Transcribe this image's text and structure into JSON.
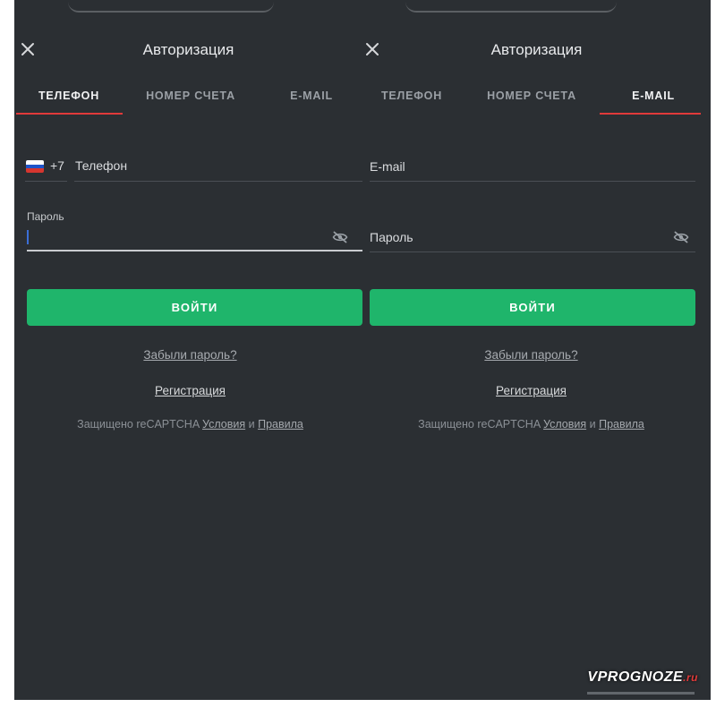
{
  "left": {
    "title": "Авторизация",
    "tabs": [
      {
        "label": "ТЕЛЕФОН",
        "active": true
      },
      {
        "label": "НОМЕР СЧЕТА",
        "active": false
      },
      {
        "label": "E-MAIL",
        "active": false
      }
    ],
    "phone": {
      "code": "+7",
      "placeholder": "Телефон"
    },
    "password_label": "Пароль",
    "login_button": "ВОЙТИ",
    "forgot_link": "Забыли пароль?",
    "register_link": "Регистрация",
    "captcha": {
      "prefix": "Защищено reCAPTCHA",
      "terms": "Условия",
      "and": "и",
      "rules": "Правила"
    }
  },
  "right": {
    "title": "Авторизация",
    "tabs": [
      {
        "label": "ТЕЛЕФОН",
        "active": false
      },
      {
        "label": "НОМЕР СЧЕТА",
        "active": false
      },
      {
        "label": "E-MAIL",
        "active": true
      }
    ],
    "email_placeholder": "E-mail",
    "password_placeholder": "Пароль",
    "login_button": "ВОЙТИ",
    "forgot_link": "Забыли пароль?",
    "register_link": "Регистрация",
    "captcha": {
      "prefix": "Защищено reCAPTCHA",
      "terms": "Условия",
      "and": "и",
      "rules": "Правила"
    }
  },
  "watermark": {
    "brand": "VPROGNOZE",
    "tld": ".ru"
  },
  "colors": {
    "accent_green": "#1fb56b",
    "tab_underline": "#e03a3a",
    "background": "#2b2f33"
  },
  "icons": {
    "close": "close-icon",
    "eye": "eye-off-icon",
    "flag": "russia-flag-icon"
  }
}
